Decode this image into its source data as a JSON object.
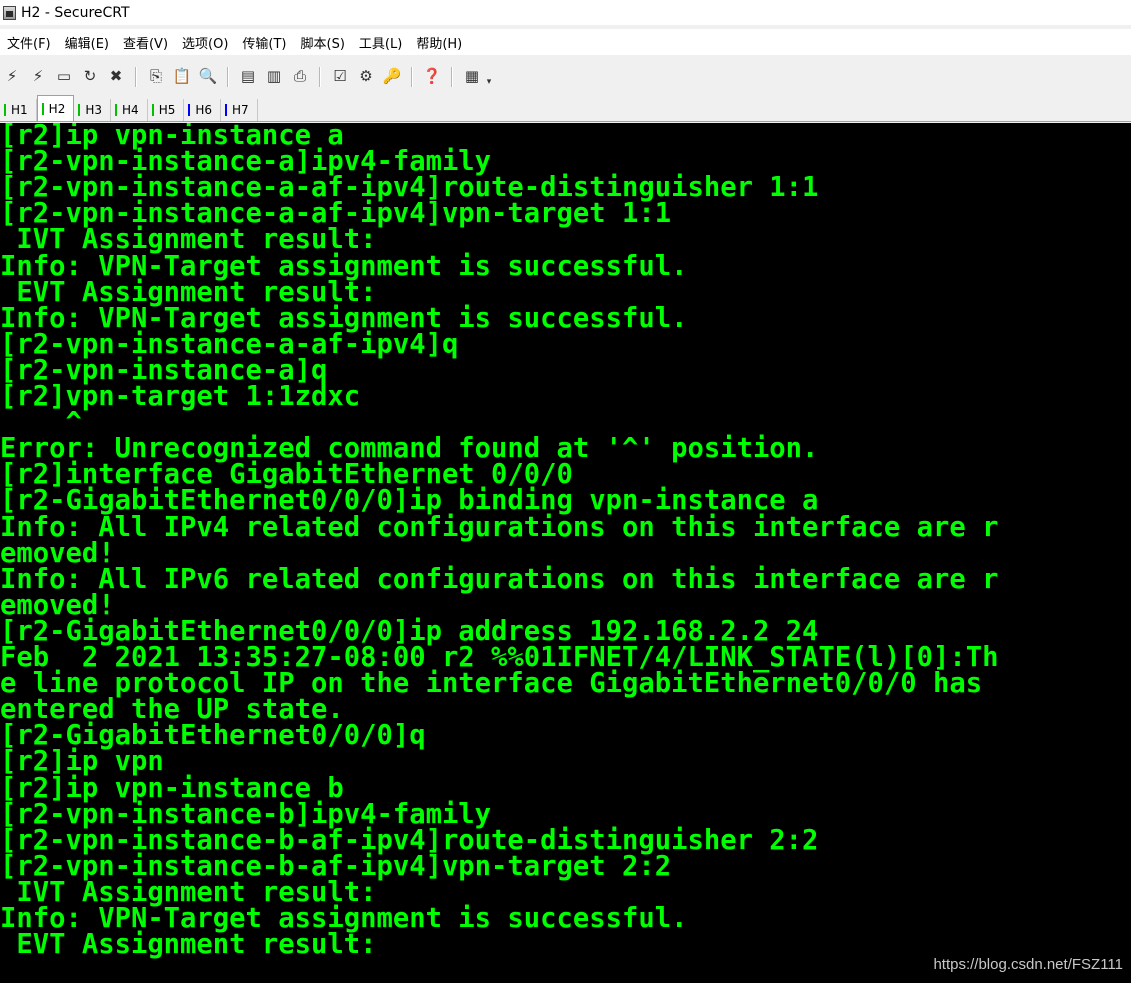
{
  "window": {
    "title": "H2 - SecureCRT"
  },
  "menu": [
    "文件(F)",
    "编辑(E)",
    "查看(V)",
    "选项(O)",
    "传输(T)",
    "脚本(S)",
    "工具(L)",
    "帮助(H)"
  ],
  "toolbar": [
    {
      "name": "connect-icon",
      "glyph": "⚡"
    },
    {
      "name": "quick-connect-icon",
      "glyph": "⚡"
    },
    {
      "name": "connect-in-tab-icon",
      "glyph": "▭"
    },
    {
      "name": "reconnect-icon",
      "glyph": "↻"
    },
    {
      "name": "disconnect-icon",
      "glyph": "✖"
    },
    {
      "sep": true
    },
    {
      "name": "copy-icon",
      "glyph": "⎘"
    },
    {
      "name": "paste-icon",
      "glyph": "📋"
    },
    {
      "name": "find-icon",
      "glyph": "🔍"
    },
    {
      "sep": true
    },
    {
      "name": "print-screen-icon",
      "glyph": "▤"
    },
    {
      "name": "print-selection-icon",
      "glyph": "▥"
    },
    {
      "name": "print-icon",
      "glyph": "⎙"
    },
    {
      "sep": true
    },
    {
      "name": "session-options-icon",
      "glyph": "☑"
    },
    {
      "name": "global-options-icon",
      "glyph": "⚙"
    },
    {
      "name": "keymap-icon",
      "glyph": "🔑"
    },
    {
      "sep": true
    },
    {
      "name": "help-icon",
      "glyph": "❓"
    },
    {
      "sep": true
    },
    {
      "name": "sftp-icon",
      "glyph": "▦"
    }
  ],
  "tabs": [
    {
      "label": "H1",
      "color": "#00c000",
      "active": false
    },
    {
      "label": "H2",
      "color": "#00c000",
      "active": true
    },
    {
      "label": "H3",
      "color": "#00c000",
      "active": false
    },
    {
      "label": "H4",
      "color": "#00c000",
      "active": false
    },
    {
      "label": "H5",
      "color": "#00c000",
      "active": false
    },
    {
      "label": "H6",
      "color": "#0000ff",
      "active": false
    },
    {
      "label": "H7",
      "color": "#0000ff",
      "active": false
    }
  ],
  "terminal": {
    "color": "#00ff00",
    "lines": [
      "[r2]ip vpn-instance a",
      "[r2-vpn-instance-a]ipv4-family",
      "[r2-vpn-instance-a-af-ipv4]route-distinguisher 1:1",
      "[r2-vpn-instance-a-af-ipv4]vpn-target 1:1",
      " IVT Assignment result:",
      "Info: VPN-Target assignment is successful.",
      " EVT Assignment result:",
      "Info: VPN-Target assignment is successful.",
      "[r2-vpn-instance-a-af-ipv4]q",
      "[r2-vpn-instance-a]q",
      "[r2]vpn-target 1:1zdxc",
      "    ^",
      "Error: Unrecognized command found at '^' position.",
      "[r2]interface GigabitEthernet 0/0/0",
      "[r2-GigabitEthernet0/0/0]ip binding vpn-instance a",
      "Info: All IPv4 related configurations on this interface are r",
      "emoved!",
      "Info: All IPv6 related configurations on this interface are r",
      "emoved!",
      "[r2-GigabitEthernet0/0/0]ip address 192.168.2.2 24",
      "Feb  2 2021 13:35:27-08:00 r2 %%01IFNET/4/LINK_STATE(l)[0]:Th",
      "e line protocol IP on the interface GigabitEthernet0/0/0 has",
      "entered the UP state.",
      "[r2-GigabitEthernet0/0/0]q",
      "[r2]ip vpn",
      "[r2]ip vpn-instance b",
      "[r2-vpn-instance-b]ipv4-family",
      "[r2-vpn-instance-b-af-ipv4]route-distinguisher 2:2",
      "[r2-vpn-instance-b-af-ipv4]vpn-target 2:2",
      " IVT Assignment result:",
      "Info: VPN-Target assignment is successful.",
      " EVT Assignment result:"
    ]
  },
  "watermark": "https://blog.csdn.net/FSZ111"
}
